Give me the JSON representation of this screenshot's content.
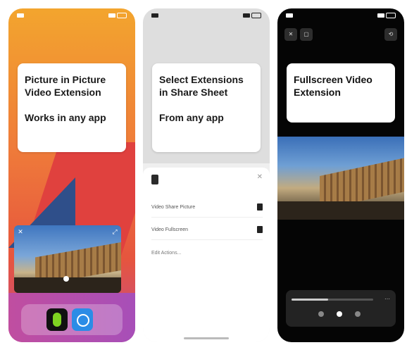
{
  "screens": [
    {
      "headline": "Picture in Picture Video Extension",
      "subtitle": "Works in any app"
    },
    {
      "headline": "Select Extensions in Share Sheet",
      "subtitle": "From any app",
      "sheet_rows": [
        {
          "label": "Video Share Picture"
        },
        {
          "label": "Video Fullscreen"
        }
      ],
      "sheet_edit": "Edit Actions..."
    },
    {
      "headline": "Fullscreen Video Extension",
      "playback_progress": 0.45
    }
  ],
  "colors": {
    "wallpaper_top": "#f3a52e",
    "wallpaper_mid": "#ef7b3a",
    "wallpaper_bottom": "#c44b8a",
    "accent_blue": "#2b8ce6",
    "accent_green": "#7ed321"
  },
  "icons": {
    "pip_close": "close-icon",
    "pip_expand": "expand-icon",
    "share_close": "close-icon",
    "dock_apps": [
      "green-app-icon",
      "blue-app-icon"
    ]
  }
}
